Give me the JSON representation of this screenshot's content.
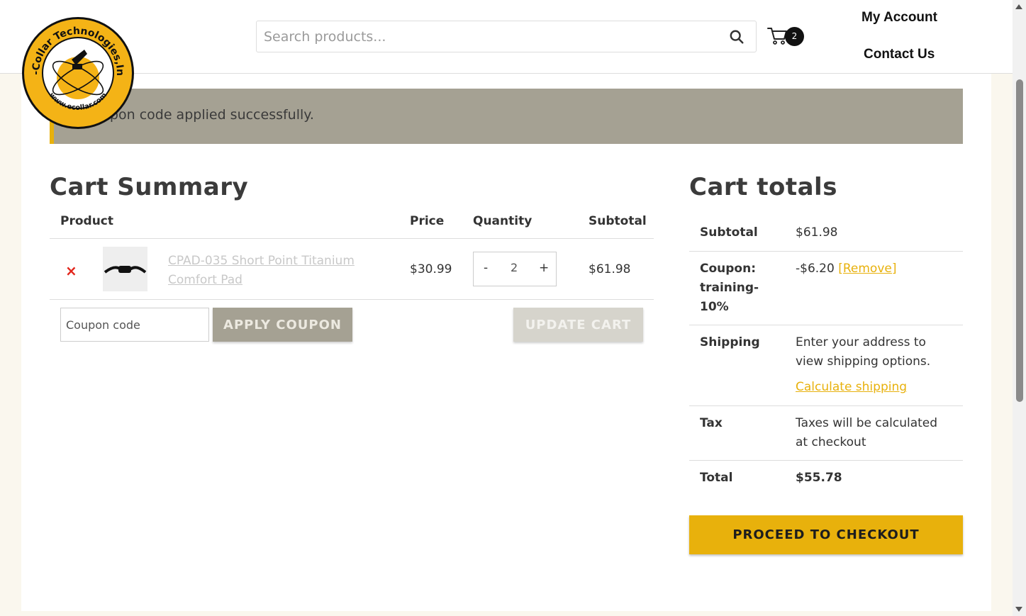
{
  "header": {
    "logo_text_top": "E-Collar Technologies,Inc",
    "logo_text_bottom": "www.ecollar.com",
    "search_placeholder": "Search products...",
    "cart_count": "2",
    "nav": {
      "account": "My Account",
      "contact": "Contact Us"
    }
  },
  "notice": {
    "message": "Coupon code applied successfully."
  },
  "cart": {
    "title": "Cart Summary",
    "columns": {
      "product": "Product",
      "price": "Price",
      "quantity": "Quantity",
      "subtotal": "Subtotal"
    },
    "items": [
      {
        "remove": "×",
        "name": "CPAD-035 Short Point Titanium Comfort Pad",
        "price": "$30.99",
        "quantity": "2",
        "subtotal": "$61.98"
      }
    ],
    "qty_minus": "-",
    "qty_plus": "+",
    "coupon_placeholder": "Coupon code",
    "apply_label": "APPLY COUPON",
    "update_label": "UPDATE CART"
  },
  "totals": {
    "title": "Cart totals",
    "subtotal_label": "Subtotal",
    "subtotal_value": "$61.98",
    "coupon_label_1": "Coupon:",
    "coupon_label_2": "training-",
    "coupon_label_3": "10%",
    "coupon_value": "-$6.20",
    "coupon_remove": "[Remove]",
    "shipping_label": "Shipping",
    "shipping_text_1": "Enter your address to",
    "shipping_text_2": "view shipping options.",
    "shipping_link": "Calculate shipping",
    "tax_label": "Tax",
    "tax_text_1": "Taxes will be calculated",
    "tax_text_2": "at checkout",
    "total_label": "Total",
    "total_value": "$55.78",
    "checkout_label": "PROCEED TO CHECKOUT"
  },
  "colors": {
    "accent": "#e8b10c",
    "notice_bg": "#a5a193",
    "remove_red": "#e2261c"
  }
}
